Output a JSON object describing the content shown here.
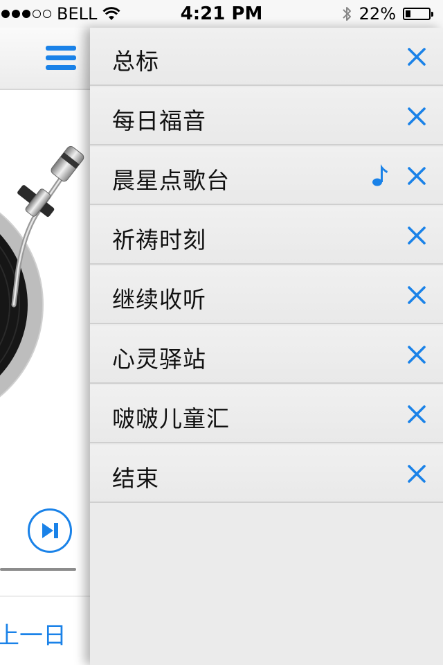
{
  "status_bar": {
    "carrier": "BELL",
    "time": "4:21 PM",
    "battery": "22%",
    "battery_level": 0.22,
    "signal_filled": 3,
    "signal_total": 5
  },
  "player": {
    "prev_day_label": "上一日",
    "icons": [
      "menu-icon",
      "next-track-icon",
      "turntable-image"
    ]
  },
  "menu": {
    "accent_color": "#1a82e8",
    "items": [
      {
        "label": "总标"
      },
      {
        "label": "每日福音"
      },
      {
        "label": "晨星点歌台",
        "playing": true
      },
      {
        "label": "祈祷时刻"
      },
      {
        "label": "继续收听"
      },
      {
        "label": "心灵驿站"
      },
      {
        "label": "啵啵儿童汇"
      },
      {
        "label": "结束"
      }
    ]
  }
}
